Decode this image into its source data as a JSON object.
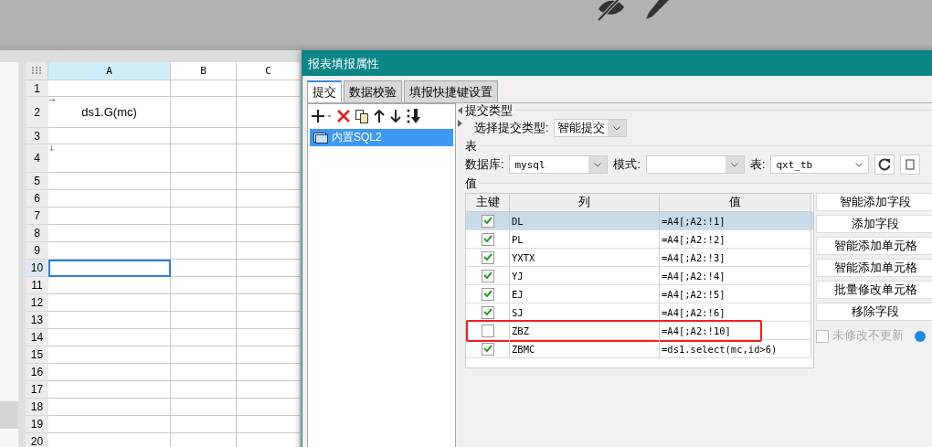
{
  "spreadsheet": {
    "columns": [
      {
        "label": "A",
        "selected": true
      },
      {
        "label": "B",
        "selected": false
      },
      {
        "label": "C",
        "selected": false
      }
    ],
    "rows": [
      {
        "label": "1",
        "selected": false
      },
      {
        "label": "2",
        "selected": false,
        "cell_a": "ds1.G(mc)",
        "expands_right": true
      },
      {
        "label": "3",
        "selected": false
      },
      {
        "label": "4",
        "selected": false,
        "expands_down": true
      },
      {
        "label": "5",
        "selected": false
      },
      {
        "label": "6",
        "selected": false
      },
      {
        "label": "7",
        "selected": false
      },
      {
        "label": "8",
        "selected": false
      },
      {
        "label": "9",
        "selected": false
      },
      {
        "label": "10",
        "selected": true
      },
      {
        "label": "11",
        "selected": false
      },
      {
        "label": "12",
        "selected": false
      },
      {
        "label": "13",
        "selected": false
      },
      {
        "label": "14",
        "selected": false
      },
      {
        "label": "15",
        "selected": false
      },
      {
        "label": "16",
        "selected": false
      },
      {
        "label": "17",
        "selected": false
      },
      {
        "label": "18",
        "selected": false
      },
      {
        "label": "19",
        "selected": false
      },
      {
        "label": "20",
        "selected": false
      }
    ]
  },
  "dialog": {
    "title": "报表填报属性",
    "tabs": [
      {
        "label": "提交",
        "selected": true
      },
      {
        "label": "数据校验",
        "selected": false
      },
      {
        "label": "填报快捷键设置",
        "selected": false
      }
    ],
    "submissions": [
      {
        "label": "内置SQL2",
        "selected": true
      }
    ],
    "submit_type": {
      "section": "提交类型",
      "label": "选择提交类型:",
      "value": "智能提交"
    },
    "table_section": {
      "section": "表",
      "database_label": "数据库:",
      "database": "mysql",
      "schema_label": "模式:",
      "table_label": "表:",
      "table": "qxt_tb"
    },
    "values_section": "值",
    "fields": {
      "columns": [
        "主键",
        "列",
        "值"
      ],
      "rows": [
        {
          "key": true,
          "column": "DL",
          "value": "=A4[;A2:!1]",
          "selected": true,
          "highlighted": false
        },
        {
          "key": true,
          "column": "PL",
          "value": "=A4[;A2:!2]",
          "selected": false,
          "highlighted": false
        },
        {
          "key": true,
          "column": "YXTX",
          "value": "=A4[;A2:!3]",
          "selected": false,
          "highlighted": false
        },
        {
          "key": true,
          "column": "YJ",
          "value": "=A4[;A2:!4]",
          "selected": false,
          "highlighted": false
        },
        {
          "key": true,
          "column": "EJ",
          "value": "=A4[;A2:!5]",
          "selected": false,
          "highlighted": false
        },
        {
          "key": true,
          "column": "SJ",
          "value": "=A4[;A2:!6]",
          "selected": false,
          "highlighted": false
        },
        {
          "key": false,
          "column": "ZBZ",
          "value": "=A4[;A2:!10]",
          "selected": false,
          "highlighted": true
        },
        {
          "key": true,
          "column": "ZBMC",
          "value": "=ds1.select(mc,id>6)",
          "selected": false,
          "highlighted": false
        }
      ]
    },
    "buttons": [
      "智能添加字段",
      "添加字段",
      "智能添加单元格",
      "智能添加单元格",
      "批量修改单元格",
      "移除字段"
    ],
    "no_update_unmodified": {
      "label": "未修改不更新",
      "checked": false,
      "disabled": true
    }
  }
}
